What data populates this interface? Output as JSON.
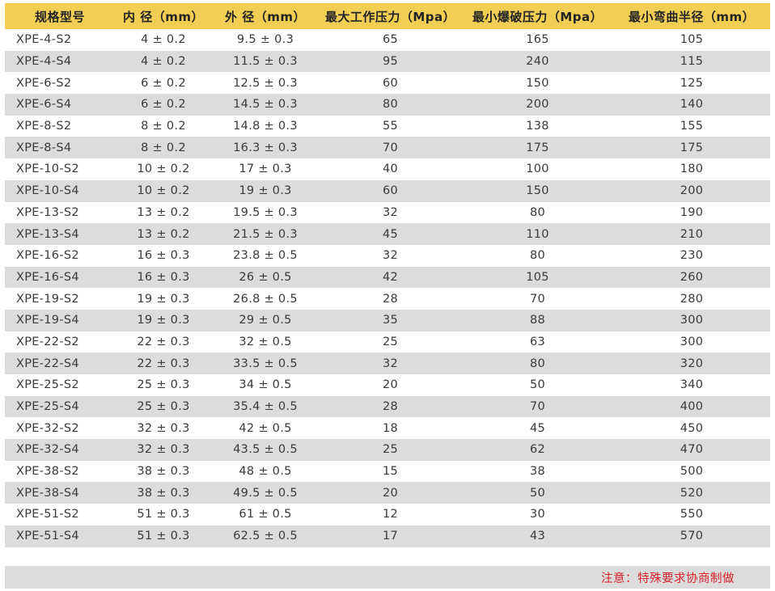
{
  "table": {
    "headers": [
      "规格型号",
      "内 径（mm）",
      "外 径（mm）",
      "最大工作压力（Mpa）",
      "最小爆破压力（Mpa）",
      "最小弯曲半径（mm）"
    ],
    "rows": [
      [
        "XPE-4-S2",
        "4 ± 0.2",
        "9.5 ± 0.3",
        "65",
        "165",
        "105"
      ],
      [
        "XPE-4-S4",
        "4 ± 0.2",
        "11.5 ± 0.3",
        "95",
        "240",
        "115"
      ],
      [
        "XPE-6-S2",
        "6 ± 0.2",
        "12.5 ± 0.3",
        "60",
        "150",
        "125"
      ],
      [
        "XPE-6-S4",
        "6 ± 0.2",
        "14.5 ± 0.3",
        "80",
        "200",
        "140"
      ],
      [
        "XPE-8-S2",
        "8 ± 0.2",
        "14.8 ± 0.3",
        "55",
        "138",
        "155"
      ],
      [
        "XPE-8-S4",
        "8 ± 0.2",
        "16.3 ± 0.3",
        "70",
        "175",
        "175"
      ],
      [
        "XPE-10-S2",
        "10 ± 0.2",
        "17 ± 0.3",
        "40",
        "100",
        "180"
      ],
      [
        "XPE-10-S4",
        "10 ± 0.2",
        "19 ± 0.3",
        "60",
        "150",
        "200"
      ],
      [
        "XPE-13-S2",
        "13 ± 0.2",
        "19.5 ± 0.3",
        "32",
        "80",
        "190"
      ],
      [
        "XPE-13-S4",
        "13 ± 0.2",
        "21.5 ± 0.3",
        "45",
        "110",
        "210"
      ],
      [
        "XPE-16-S2",
        "16 ± 0.3",
        "23.8 ± 0.5",
        "32",
        "80",
        "230"
      ],
      [
        "XPE-16-S4",
        "16 ± 0.3",
        "26 ± 0.5",
        "42",
        "105",
        "260"
      ],
      [
        "XPE-19-S2",
        "19 ± 0.3",
        "26.8 ± 0.5",
        "28",
        "70",
        "280"
      ],
      [
        "XPE-19-S4",
        "19 ± 0.3",
        "29 ± 0.5",
        "35",
        "88",
        "300"
      ],
      [
        "XPE-22-S2",
        "22 ± 0.3",
        "32 ± 0.5",
        "25",
        "63",
        "300"
      ],
      [
        "XPE-22-S4",
        "22 ± 0.3",
        "33.5 ± 0.5",
        "32",
        "80",
        "320"
      ],
      [
        "XPE-25-S2",
        "25 ± 0.3",
        "34 ± 0.5",
        "20",
        "50",
        "340"
      ],
      [
        "XPE-25-S4",
        "25 ± 0.3",
        "35.4 ± 0.5",
        "28",
        "70",
        "400"
      ],
      [
        "XPE-32-S2",
        "32 ± 0.3",
        "42 ± 0.5",
        "18",
        "45",
        "450"
      ],
      [
        "XPE-32-S4",
        "32 ± 0.3",
        "43.5 ± 0.5",
        "25",
        "62",
        "470"
      ],
      [
        "XPE-38-S2",
        "38 ± 0.3",
        "48 ± 0.5",
        "15",
        "38",
        "500"
      ],
      [
        "XPE-38-S4",
        "38 ± 0.3",
        "49.5 ± 0.5",
        "20",
        "50",
        "520"
      ],
      [
        "XPE-51-S2",
        "51 ± 0.3",
        "61 ± 0.5",
        "12",
        "30",
        "550"
      ],
      [
        "XPE-51-S4",
        "51 ± 0.3",
        "62.5 ± 0.5",
        "17",
        "43",
        "570"
      ]
    ]
  },
  "note": "注意：特殊要求协商制做",
  "colors": {
    "header_bg": "#f3ce55",
    "stripe_bg": "#dcdcdc",
    "note_text": "#d8222a"
  }
}
